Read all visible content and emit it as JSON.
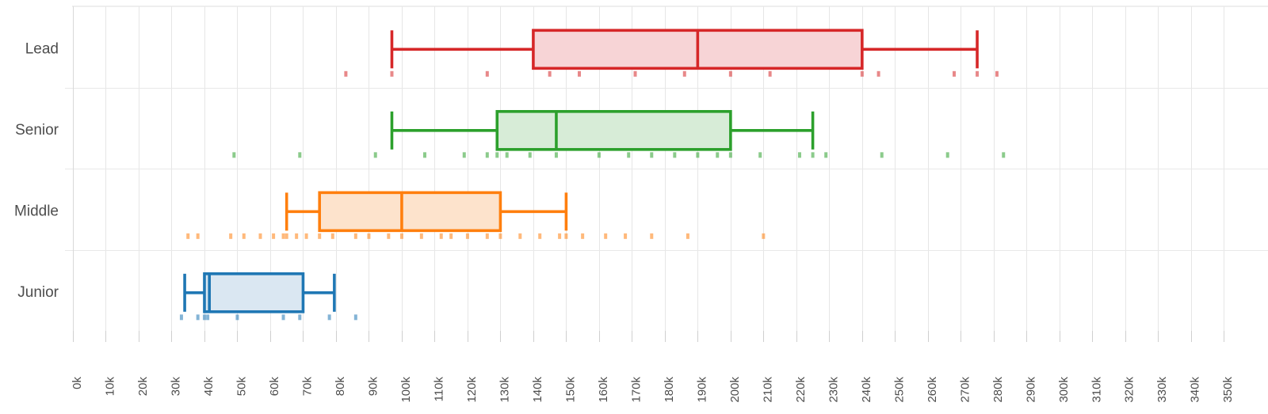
{
  "chart_data": {
    "type": "box",
    "title": "",
    "xlabel": "",
    "ylabel": "",
    "orientation": "horizontal",
    "xlim": [
      0,
      355000
    ],
    "xticks": [
      "0k",
      "10k",
      "20k",
      "30k",
      "40k",
      "50k",
      "60k",
      "70k",
      "80k",
      "90k",
      "100k",
      "110k",
      "120k",
      "130k",
      "140k",
      "150k",
      "160k",
      "170k",
      "180k",
      "190k",
      "200k",
      "210k",
      "220k",
      "230k",
      "240k",
      "250k",
      "260k",
      "270k",
      "280k",
      "290k",
      "300k",
      "310k",
      "320k",
      "330k",
      "340k",
      "350k"
    ],
    "xtick_values": [
      0,
      10000,
      20000,
      30000,
      40000,
      50000,
      60000,
      70000,
      80000,
      90000,
      100000,
      110000,
      120000,
      130000,
      140000,
      150000,
      160000,
      170000,
      180000,
      190000,
      200000,
      210000,
      220000,
      230000,
      240000,
      250000,
      260000,
      270000,
      280000,
      290000,
      300000,
      310000,
      320000,
      330000,
      340000,
      350000
    ],
    "categories": [
      "Lead",
      "Senior",
      "Middle",
      "Junior"
    ],
    "grid": true,
    "legend": "none",
    "boxes": [
      {
        "category": "Lead",
        "color": "#d62728",
        "fill": "#f7d4d6",
        "whisker_low": 97000,
        "q1": 140000,
        "median": 190000,
        "q3": 240000,
        "whisker_high": 275000,
        "points": [
          83000,
          97000,
          126000,
          145000,
          154000,
          171000,
          186000,
          200000,
          212000,
          240000,
          245000,
          268000,
          275000,
          281000
        ]
      },
      {
        "category": "Senior",
        "color": "#2ca02c",
        "fill": "#d7ecd7",
        "whisker_low": 97000,
        "q1": 129000,
        "median": 147000,
        "q3": 200000,
        "whisker_high": 225000,
        "points": [
          49000,
          69000,
          92000,
          107000,
          119000,
          126000,
          129000,
          132000,
          139000,
          147000,
          160000,
          169000,
          176000,
          183000,
          190000,
          196000,
          200000,
          209000,
          221000,
          225000,
          229000,
          246000,
          266000,
          283000
        ]
      },
      {
        "category": "Middle",
        "color": "#ff7f0e",
        "fill": "#fde3cc",
        "whisker_low": 65000,
        "q1": 75000,
        "median": 100000,
        "q3": 130000,
        "whisker_high": 150000,
        "points": [
          35000,
          38000,
          48000,
          52000,
          57000,
          61000,
          64000,
          65000,
          68000,
          71000,
          75000,
          79000,
          86000,
          90000,
          96000,
          100000,
          106000,
          112000,
          115000,
          120000,
          126000,
          130000,
          136000,
          142000,
          148000,
          150000,
          155000,
          162000,
          168000,
          176000,
          187000,
          210000
        ]
      },
      {
        "category": "Junior",
        "color": "#1f77b4",
        "fill": "#dae7f2",
        "whisker_low": 34000,
        "q1": 40000,
        "median": 41500,
        "q3": 70000,
        "whisker_high": 79500,
        "points": [
          33000,
          38000,
          40000,
          41000,
          50000,
          64000,
          69000,
          78000,
          86000
        ]
      }
    ]
  },
  "axis": {
    "y_labels": [
      "Lead",
      "Senior",
      "Middle",
      "Junior"
    ]
  }
}
